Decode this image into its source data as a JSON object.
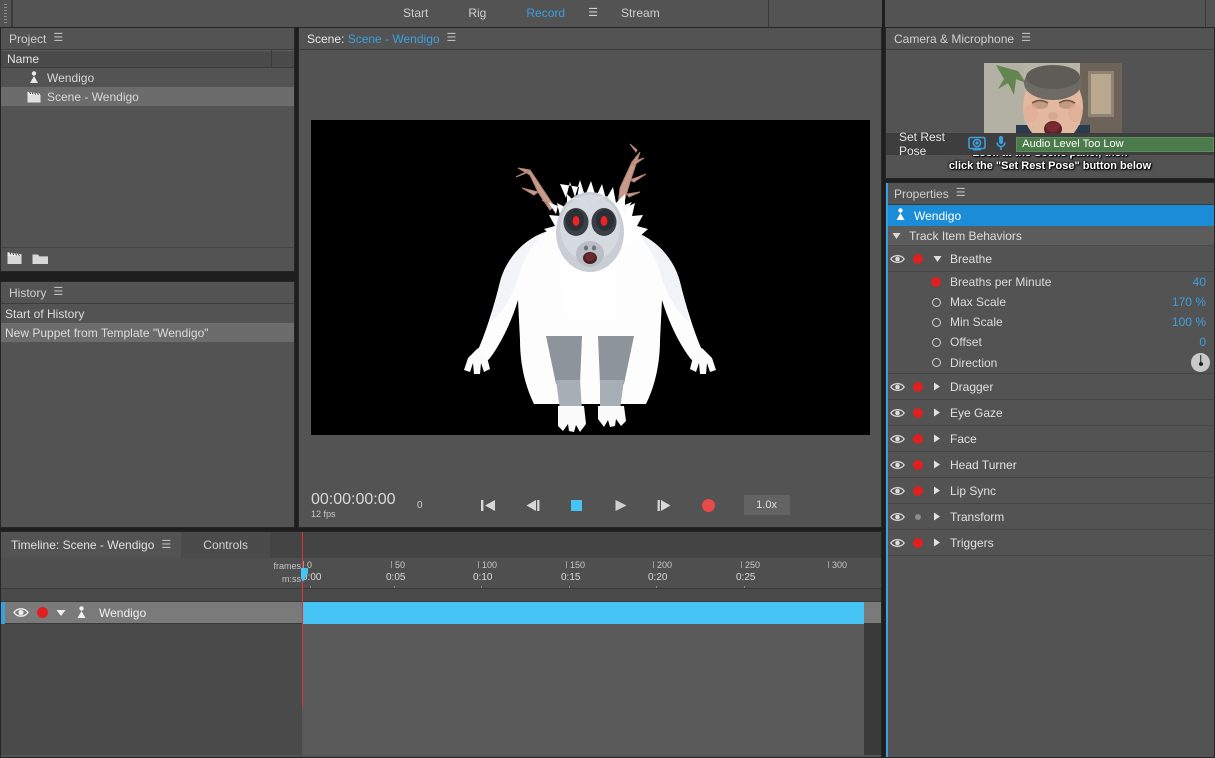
{
  "topbar": {
    "workspaces": [
      {
        "label": "Start",
        "active": false
      },
      {
        "label": "Rig",
        "active": false
      },
      {
        "label": "Record",
        "active": true
      },
      {
        "label": "Stream",
        "active": false
      }
    ],
    "menu_icon": "hamburger-icon"
  },
  "project": {
    "title": "Project",
    "menu_icon": "hamburger-icon",
    "column_header": "Name",
    "items": [
      {
        "label": "Wendigo",
        "icon": "puppet-icon",
        "selected": false
      },
      {
        "label": "Scene - Wendigo",
        "icon": "clapperboard-icon",
        "selected": true
      }
    ],
    "footer_icons": [
      "new-scene-icon",
      "new-folder-icon"
    ]
  },
  "history": {
    "title": "History",
    "menu_icon": "hamburger-icon",
    "items": [
      {
        "label": "Start of History",
        "selected": false
      },
      {
        "label": "New Puppet from Template \"Wendigo\"",
        "selected": true
      }
    ]
  },
  "scene": {
    "title_prefix": "Scene:",
    "title_name": "Scene - Wendigo",
    "menu_icon": "hamburger-icon",
    "transport": {
      "timecode": "00:00:00:00",
      "fps": "12 fps",
      "frame_number": "0",
      "speed": "1.0x",
      "buttons": [
        {
          "name": "go-to-start-icon"
        },
        {
          "name": "step-back-icon"
        },
        {
          "name": "stop-icon"
        },
        {
          "name": "play-icon"
        },
        {
          "name": "step-forward-icon"
        },
        {
          "name": "record-icon"
        }
      ]
    }
  },
  "camera": {
    "title": "Camera & Microphone",
    "menu_icon": "hamburger-icon",
    "overlay_line1": "Look at the Scene panel, then",
    "overlay_line2": "click the \"Set Rest Pose\" button below",
    "set_rest_pose": "Set Rest Pose",
    "camera_icon": "camera-icon",
    "mic_icon": "microphone-icon",
    "audio_status": "Audio Level Too Low",
    "audio_status_color": "#4b7a4b"
  },
  "properties": {
    "title": "Properties",
    "menu_icon": "hamburger-icon",
    "object_name": "Wendigo",
    "object_icon": "puppet-icon",
    "object_color": "#1a8cd8",
    "section_label": "Track Item Behaviors",
    "behaviors": [
      {
        "name": "Breathe",
        "expanded": true,
        "visible": true,
        "armed": true,
        "params": [
          {
            "label": "Breaths per Minute",
            "value": "40",
            "unit": "",
            "armed": true,
            "control": "dot"
          },
          {
            "label": "Max Scale",
            "value": "170",
            "unit": "%",
            "armed": false,
            "control": "circle"
          },
          {
            "label": "Min Scale",
            "value": "100",
            "unit": "%",
            "armed": false,
            "control": "circle"
          },
          {
            "label": "Offset",
            "value": "0",
            "unit": "",
            "armed": false,
            "control": "circle"
          },
          {
            "label": "Direction",
            "value": "",
            "unit": "",
            "armed": false,
            "control": "circle",
            "widget": "dial"
          }
        ]
      },
      {
        "name": "Dragger",
        "expanded": false,
        "visible": true,
        "armed": true,
        "params": []
      },
      {
        "name": "Eye Gaze",
        "expanded": false,
        "visible": true,
        "armed": true,
        "params": []
      },
      {
        "name": "Face",
        "expanded": false,
        "visible": true,
        "armed": true,
        "params": []
      },
      {
        "name": "Head Turner",
        "expanded": false,
        "visible": true,
        "armed": true,
        "params": []
      },
      {
        "name": "Lip Sync",
        "expanded": false,
        "visible": true,
        "armed": true,
        "params": []
      },
      {
        "name": "Transform",
        "expanded": false,
        "visible": true,
        "armed": false,
        "params": []
      },
      {
        "name": "Triggers",
        "expanded": false,
        "visible": true,
        "armed": true,
        "params": []
      }
    ]
  },
  "timeline": {
    "tab_label": "Timeline: Scene - Wendigo",
    "menu_icon": "hamburger-icon",
    "controls_tab": "Controls",
    "ruler_label_frames": "frames",
    "ruler_label_time": "m:ss",
    "frame_ticks": [
      "0",
      "50",
      "100",
      "150",
      "200",
      "250",
      "300"
    ],
    "time_ticks": [
      "0:00",
      "0:05",
      "0:10",
      "0:15",
      "0:20",
      "0:25"
    ],
    "track": {
      "name": "Wendigo",
      "icon": "puppet-icon",
      "visible": true,
      "armed": true,
      "bar_color": "#45c4f5"
    },
    "playhead_frame": "0"
  }
}
